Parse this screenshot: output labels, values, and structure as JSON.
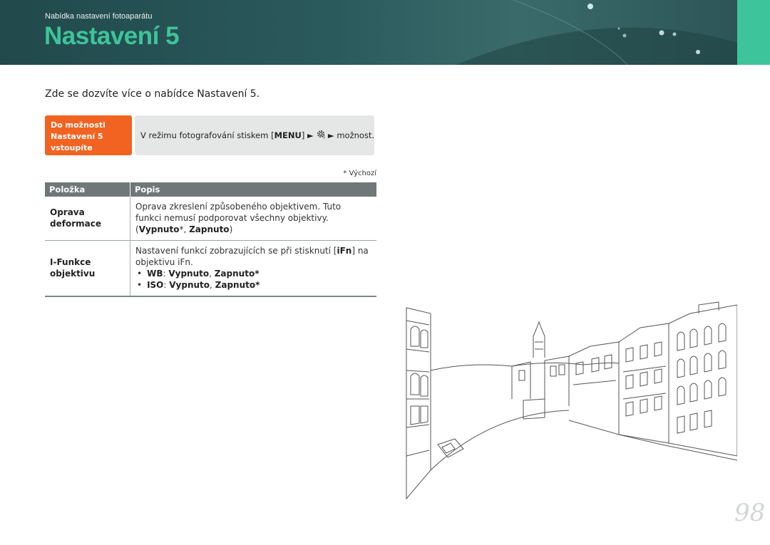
{
  "header": {
    "breadcrumb": "Nabídka nastavení fotoaparátu",
    "title": "Nastavení 5",
    "colors": {
      "band": "#2b5a5c",
      "accent": "#3ec49a"
    }
  },
  "intro": "Zde se dozvíte více o nabídce Nastavení 5.",
  "access": {
    "label_line1": "Do možnosti",
    "label_line2": "Nastavení 5",
    "label_line3": "vstoupíte",
    "text_prefix": "V režimu fotografování stiskem [",
    "menu_key": "MENU",
    "text_after_menu": "] ►",
    "gear_icon": "gear-icon",
    "text_suffix": "► možnost.",
    "label_color": "#f26322"
  },
  "default_note": "* Výchozí",
  "table": {
    "headers": [
      "Položka",
      "Popis"
    ],
    "rows": [
      {
        "item_line1": "Oprava",
        "item_line2": "deformace",
        "desc_line1": "Oprava zkreslení způsobeného objektivem. Tuto",
        "desc_line2": "funkci nemusí podporovat všechny objektivy.",
        "options_open": "(",
        "option1": "Vypnuto",
        "option1_suffix": "*, ",
        "option2": "Zapnuto",
        "options_close": ")"
      },
      {
        "item_line1": "I-Funkce",
        "item_line2": "objektivu",
        "desc_line1": "Nastavení funkcí zobrazujících se při stisknutí [",
        "ifn_key": "iFn",
        "desc_line1_end": "] na",
        "desc_line2": "objektivu iFn.",
        "bullet1_label": "WB",
        "bullet1_sep": ": ",
        "bullet1_opt1": "Vypnuto",
        "bullet1_comma": ", ",
        "bullet1_opt2": "Zapnuto*",
        "bullet2_label": "ISO",
        "bullet2_sep": ": ",
        "bullet2_opt1": "Vypnuto",
        "bullet2_comma": ", ",
        "bullet2_opt2": "Zapnuto*"
      }
    ]
  },
  "page_number": "98"
}
